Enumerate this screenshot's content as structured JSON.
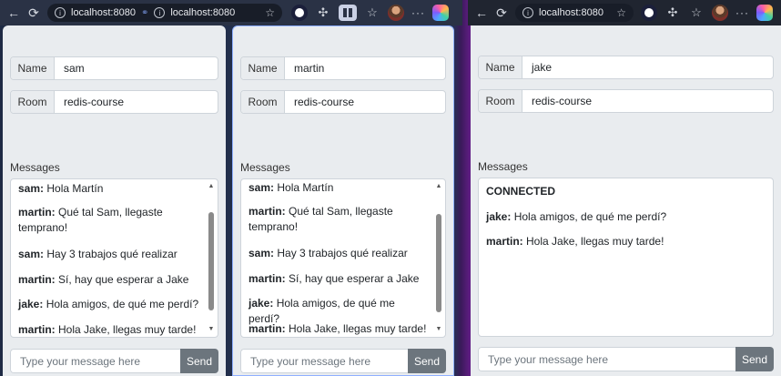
{
  "browser": {
    "left_tabs": [
      "localhost:8080",
      "localhost:8080"
    ],
    "right_tab": "localhost:8080"
  },
  "ui": {
    "name_label": "Name",
    "room_label": "Room",
    "messages_label": "Messages",
    "composer_placeholder": "Type your message here",
    "send_label": "Send"
  },
  "panes": [
    {
      "name": "sam",
      "room": "redis-course",
      "messages": [
        {
          "user": "sam:",
          "text": " Hola Martín"
        },
        {
          "user": "martin:",
          "text": " Qué tal Sam, llegaste temprano!"
        },
        {
          "user": "sam:",
          "text": " Hay 3 trabajos qué realizar"
        },
        {
          "user": "martin:",
          "text": " Sí, hay que esperar a Jake"
        },
        {
          "user": "jake:",
          "text": " Hola amigos, de qué me perdí?"
        },
        {
          "user": "martin:",
          "text": " Hola Jake, llegas muy tarde!"
        }
      ]
    },
    {
      "name": "martin",
      "room": "redis-course",
      "messages": [
        {
          "user": "sam:",
          "text": " Hola Martín"
        },
        {
          "user": "martin:",
          "text": " Qué tal Sam, llegaste temprano!"
        },
        {
          "user": "sam:",
          "text": " Hay 3 trabajos qué realizar"
        },
        {
          "user": "martin:",
          "text": " Sí, hay que esperar a Jake"
        },
        {
          "user": "jake:",
          "text": " Hola amigos, de qué me perdí?"
        },
        {
          "user": "martin:",
          "text": " Hola Jake, llegas muy tarde!"
        }
      ]
    },
    {
      "name": "jake",
      "room": "redis-course",
      "status": "CONNECTED",
      "messages": [
        {
          "user": "jake:",
          "text": " Hola amigos, de qué me perdí?"
        },
        {
          "user": "martin:",
          "text": " Hola Jake, llegas muy tarde!"
        }
      ]
    }
  ]
}
